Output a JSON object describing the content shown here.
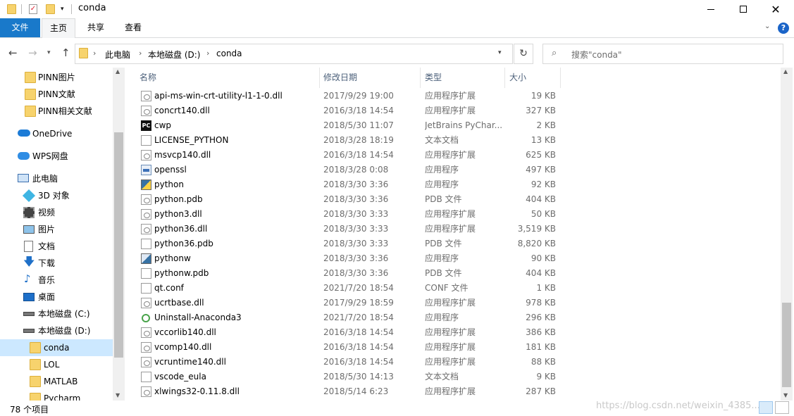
{
  "window": {
    "title": "conda"
  },
  "ribbon": {
    "tabs": [
      "文件",
      "主页",
      "共享",
      "查看"
    ],
    "help_label": "?"
  },
  "address": {
    "crumbs": [
      "此电脑",
      "本地磁盘 (D:)",
      "conda"
    ],
    "search_placeholder": "搜索\"conda\""
  },
  "nav": {
    "items": [
      {
        "label": "PINN图片",
        "icon": "folder-icon"
      },
      {
        "label": "PINN文献",
        "icon": "folder-icon"
      },
      {
        "label": "PINN相关文献",
        "icon": "folder-icon"
      },
      {
        "label": "OneDrive",
        "icon": "cloud-icon"
      },
      {
        "label": "WPS网盘",
        "icon": "wps-cloud-icon"
      },
      {
        "label": "此电脑",
        "icon": "computer-icon"
      },
      {
        "label": "3D 对象",
        "icon": "3d-objects-icon"
      },
      {
        "label": "视频",
        "icon": "video-icon"
      },
      {
        "label": "图片",
        "icon": "pictures-icon"
      },
      {
        "label": "文档",
        "icon": "documents-icon"
      },
      {
        "label": "下载",
        "icon": "download-icon"
      },
      {
        "label": "音乐",
        "icon": "music-icon"
      },
      {
        "label": "桌面",
        "icon": "desktop-icon"
      },
      {
        "label": "本地磁盘 (C:)",
        "icon": "drive-icon"
      },
      {
        "label": "本地磁盘 (D:)",
        "icon": "drive-icon"
      },
      {
        "label": "conda",
        "icon": "folder-icon"
      },
      {
        "label": "LOL",
        "icon": "folder-icon"
      },
      {
        "label": "MATLAB",
        "icon": "folder-icon"
      },
      {
        "label": "Pycharm",
        "icon": "folder-icon"
      }
    ],
    "selected": "conda"
  },
  "columns": {
    "name": "名称",
    "date": "修改日期",
    "type": "类型",
    "size": "大小"
  },
  "files": [
    {
      "name": "api-ms-win-crt-utility-l1-1-0.dll",
      "date": "2017/9/29 19:00",
      "type": "应用程序扩展",
      "size": "19 KB",
      "icon": "dll"
    },
    {
      "name": "concrt140.dll",
      "date": "2016/3/18 14:54",
      "type": "应用程序扩展",
      "size": "327 KB",
      "icon": "dll"
    },
    {
      "name": "cwp",
      "date": "2018/5/30 11:07",
      "type": "JetBrains PyChar...",
      "size": "2 KB",
      "icon": "pc"
    },
    {
      "name": "LICENSE_PYTHON",
      "date": "2018/3/28 18:19",
      "type": "文本文档",
      "size": "13 KB",
      "icon": "file"
    },
    {
      "name": "msvcp140.dll",
      "date": "2016/3/18 14:54",
      "type": "应用程序扩展",
      "size": "625 KB",
      "icon": "dll"
    },
    {
      "name": "openssl",
      "date": "2018/3/28 0:08",
      "type": "应用程序",
      "size": "497 KB",
      "icon": "exe"
    },
    {
      "name": "python",
      "date": "2018/3/30 3:36",
      "type": "应用程序",
      "size": "92 KB",
      "icon": "py"
    },
    {
      "name": "python.pdb",
      "date": "2018/3/30 3:36",
      "type": "PDB 文件",
      "size": "404 KB",
      "icon": "dll"
    },
    {
      "name": "python3.dll",
      "date": "2018/3/30 3:33",
      "type": "应用程序扩展",
      "size": "50 KB",
      "icon": "dll"
    },
    {
      "name": "python36.dll",
      "date": "2018/3/30 3:33",
      "type": "应用程序扩展",
      "size": "3,519 KB",
      "icon": "dll"
    },
    {
      "name": "python36.pdb",
      "date": "2018/3/30 3:33",
      "type": "PDB 文件",
      "size": "8,820 KB",
      "icon": "file"
    },
    {
      "name": "pythonw",
      "date": "2018/3/30 3:36",
      "type": "应用程序",
      "size": "90 KB",
      "icon": "pyw"
    },
    {
      "name": "pythonw.pdb",
      "date": "2018/3/30 3:36",
      "type": "PDB 文件",
      "size": "404 KB",
      "icon": "file"
    },
    {
      "name": "qt.conf",
      "date": "2021/7/20 18:54",
      "type": "CONF 文件",
      "size": "1 KB",
      "icon": "file"
    },
    {
      "name": "ucrtbase.dll",
      "date": "2017/9/29 18:59",
      "type": "应用程序扩展",
      "size": "978 KB",
      "icon": "dll"
    },
    {
      "name": "Uninstall-Anaconda3",
      "date": "2021/7/20 18:54",
      "type": "应用程序",
      "size": "296 KB",
      "icon": "uninst"
    },
    {
      "name": "vccorlib140.dll",
      "date": "2016/3/18 14:54",
      "type": "应用程序扩展",
      "size": "386 KB",
      "icon": "dll"
    },
    {
      "name": "vcomp140.dll",
      "date": "2016/3/18 14:54",
      "type": "应用程序扩展",
      "size": "181 KB",
      "icon": "dll"
    },
    {
      "name": "vcruntime140.dll",
      "date": "2016/3/18 14:54",
      "type": "应用程序扩展",
      "size": "88 KB",
      "icon": "dll"
    },
    {
      "name": "vscode_eula",
      "date": "2018/5/30 14:13",
      "type": "文本文档",
      "size": "9 KB",
      "icon": "file"
    },
    {
      "name": "xlwings32-0.11.8.dll",
      "date": "2018/5/14 6:23",
      "type": "应用程序扩展",
      "size": "287 KB",
      "icon": "dll"
    }
  ],
  "status": {
    "item_count": "78 个项目",
    "watermark": "https://blog.csdn.net/weixin_4385..."
  },
  "colors": {
    "accent": "#1979ca",
    "selection": "#cce8ff",
    "folder": "#f7d36d"
  }
}
